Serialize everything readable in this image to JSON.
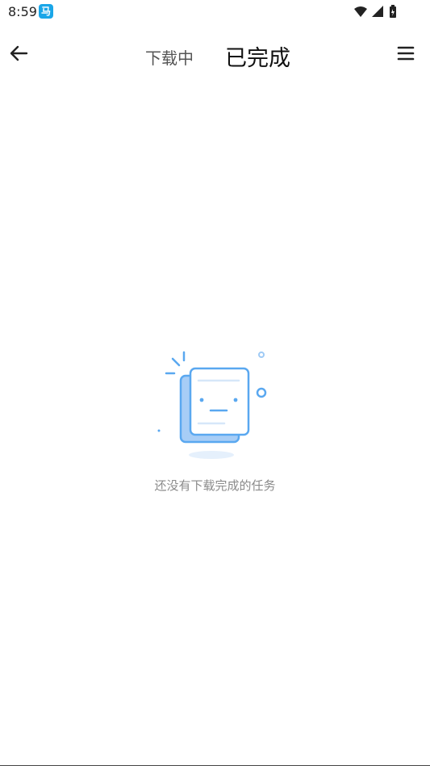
{
  "status_bar": {
    "time": "8:59",
    "app_badge_icon": "app-notification-icon",
    "icons": [
      "wifi-icon",
      "signal-icon",
      "battery-icon"
    ]
  },
  "header": {
    "tabs": [
      {
        "label": "下载中",
        "active": false
      },
      {
        "label": "已完成",
        "active": true
      }
    ],
    "back_icon": "arrow-left-icon",
    "menu_icon": "menu-icon"
  },
  "empty_state": {
    "message": "还没有下载完成的任务",
    "illustration_icon": "empty-document-icon"
  },
  "colors": {
    "illustration_blue": "#5aa8f0",
    "text_gray": "#8a8a8a"
  }
}
